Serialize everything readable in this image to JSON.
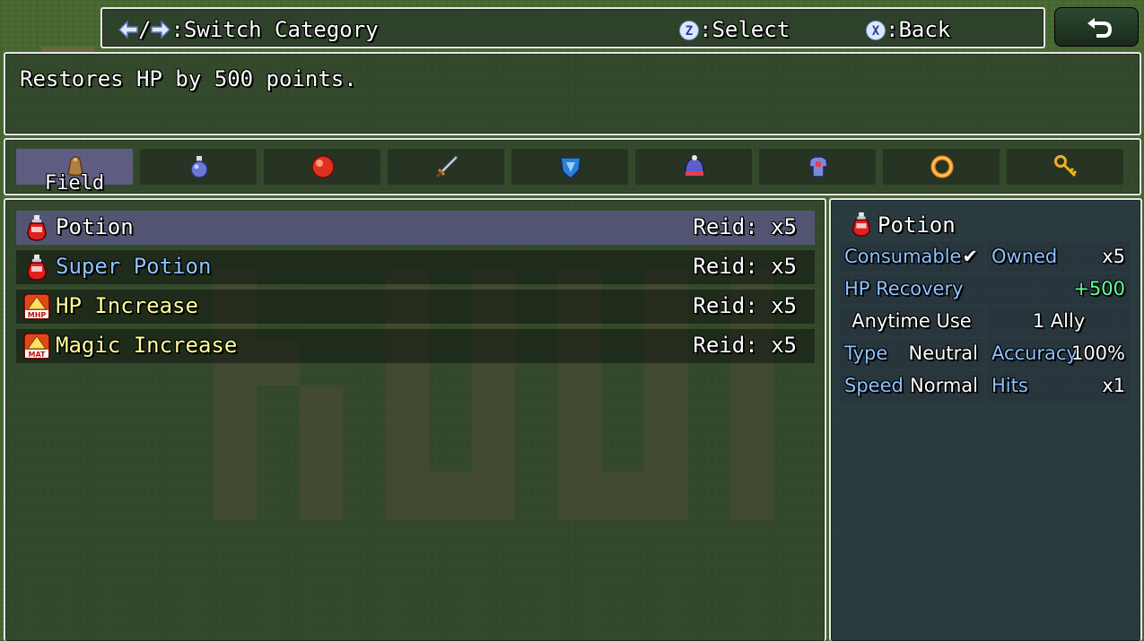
{
  "help": {
    "left_arrow_icon": "left-arrow",
    "slash": "/",
    "right_arrow_icon": "right-arrow",
    "switch_label": ":Switch Category",
    "select_key": "Z",
    "select_label": ":Select",
    "back_key": "X",
    "back_label": ":Back"
  },
  "back_button_icon": "return-arrow",
  "description": "Restores HP by 500 points.",
  "categories": [
    {
      "icon": "bag-icon",
      "label": "Field",
      "selected": true
    },
    {
      "icon": "potion-flask-icon",
      "label": ""
    },
    {
      "icon": "red-orb-icon",
      "label": ""
    },
    {
      "icon": "sword-icon",
      "label": ""
    },
    {
      "icon": "shield-icon",
      "label": ""
    },
    {
      "icon": "helmet-icon",
      "label": ""
    },
    {
      "icon": "armor-icon",
      "label": ""
    },
    {
      "icon": "ring-icon",
      "label": ""
    },
    {
      "icon": "key-icon",
      "label": ""
    }
  ],
  "items": [
    {
      "name": "Potion",
      "qty": "Reid: x5",
      "color": "#ffffff",
      "icon": "potion-icon",
      "selected": true
    },
    {
      "name": "Super Potion",
      "qty": "Reid: x5",
      "color": "#8ec3ff",
      "icon": "potion-icon"
    },
    {
      "name": "HP Increase",
      "qty": "Reid: x5",
      "color": "#ffff99",
      "icon": "mhp-up-icon",
      "badge": "MHP"
    },
    {
      "name": "Magic Increase",
      "qty": "Reid: x5",
      "color": "#ffff99",
      "icon": "mat-up-icon",
      "badge": "MAT"
    }
  ],
  "detail": {
    "title": "Potion",
    "consumable": "Consumable",
    "check": "✔",
    "owned_label": "Owned",
    "owned_value": "x5",
    "hp_recovery_label": "HP Recovery",
    "hp_recovery_value": "+500",
    "occasion": "Anytime Use",
    "scope": "1 Ally",
    "type_label": "Type",
    "type_value": "Neutral",
    "accuracy_label": "Accuracy",
    "accuracy_value": "100%",
    "speed_label": "Speed",
    "speed_value": "Normal",
    "hits_label": "Hits",
    "hits_value": "x1"
  },
  "colors": {
    "system_blue": "#8ec3ff",
    "power_up": "#66ff99",
    "selection": "#7a66c8"
  }
}
